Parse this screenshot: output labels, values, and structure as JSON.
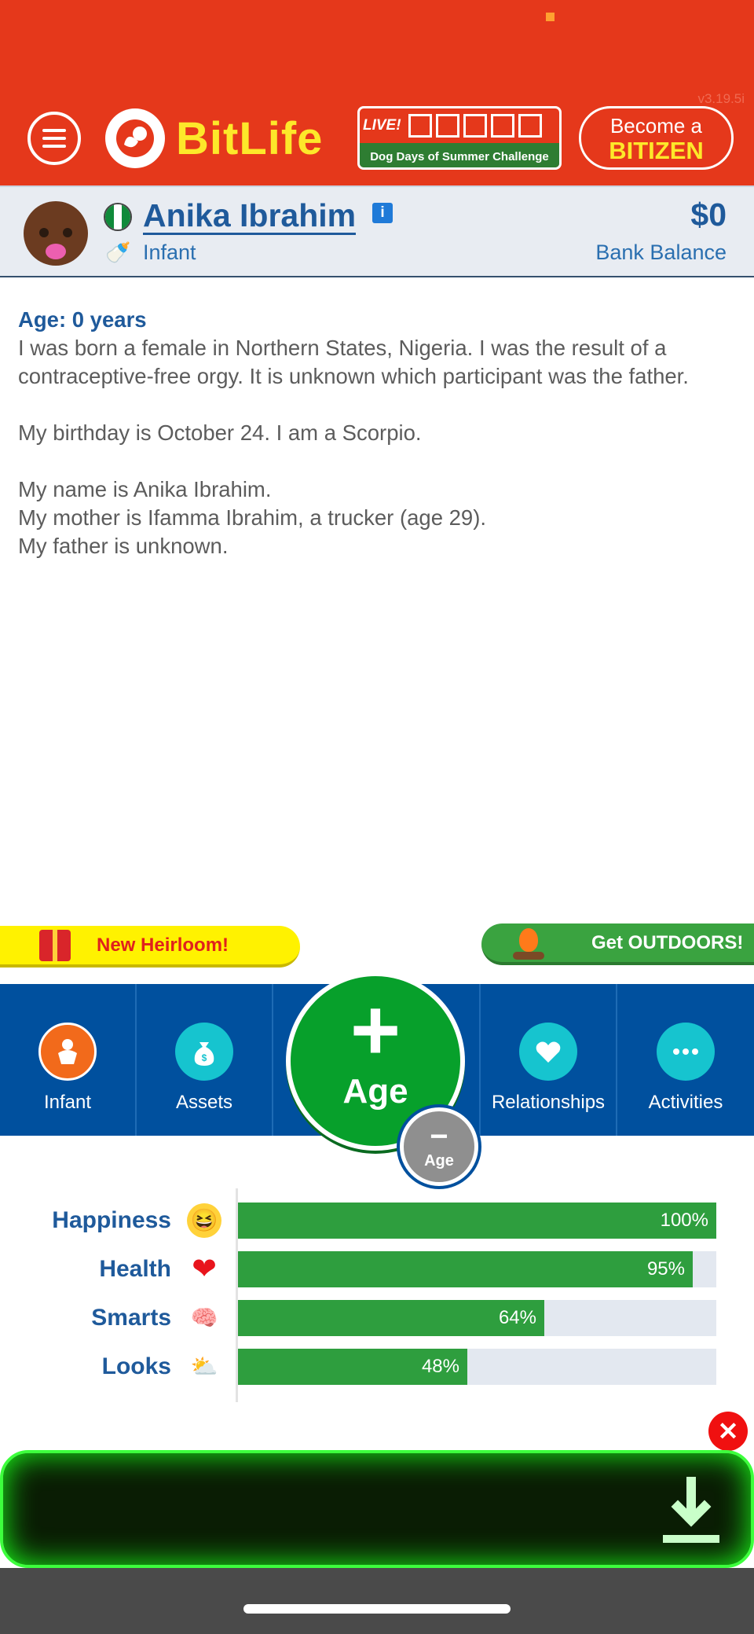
{
  "header": {
    "version": "v3.19.5i",
    "logo_text": "BitLife",
    "live": {
      "label": "LIVE!",
      "challenge": "Dog Days of Summer Challenge"
    },
    "bitizen": {
      "line1": "Become a",
      "line2": "BITIZEN"
    },
    "colors": {
      "header_bg": "#e5381b",
      "logo_yellow": "#fde82a"
    }
  },
  "profile": {
    "name": "Anika Ibrahim",
    "life_stage": "Infant",
    "balance": "$0",
    "balance_label": "Bank Balance",
    "flag_icon": "nigeria-flag-icon",
    "stage_icon": "baby-bottle-icon"
  },
  "story": {
    "age_heading": "Age: 0 years",
    "line1": "I was born a female in Northern States, Nigeria. I was the result of a contraceptive-free orgy. It is unknown which participant was the father.",
    "line2": "My birthday is October 24. I am a Scorpio.",
    "line3": "My name is Anika Ibrahim.",
    "line4": "My mother is Ifamma Ibrahim, a trucker (age 29).",
    "line5": "My father is unknown."
  },
  "banners": {
    "heirloom": "New Heirloom!",
    "outdoors": "Get OUTDOORS!"
  },
  "nav": {
    "infant": "Infant",
    "assets": "Assets",
    "age_plus": "+",
    "age": "Age",
    "age_minus": "−",
    "age_minus_label": "Age",
    "relationships": "Relationships",
    "activities": "Activities",
    "colors": {
      "nav_bg": "#00509e",
      "age_green": "#07a02b",
      "infant_orange": "#f26a1b",
      "teal": "#16c4cf"
    }
  },
  "stats": [
    {
      "label": "Happiness",
      "percent": 100,
      "percent_text": "100%",
      "icon": "laughing-face-icon"
    },
    {
      "label": "Health",
      "percent": 95,
      "percent_text": "95%",
      "icon": "heart-icon"
    },
    {
      "label": "Smarts",
      "percent": 64,
      "percent_text": "64%",
      "icon": "brain-icon"
    },
    {
      "label": "Looks",
      "percent": 48,
      "percent_text": "48%",
      "icon": "sun-cloud-icon"
    }
  ],
  "ad": {
    "close": "✕",
    "download_icon": "download-arrow-icon"
  }
}
